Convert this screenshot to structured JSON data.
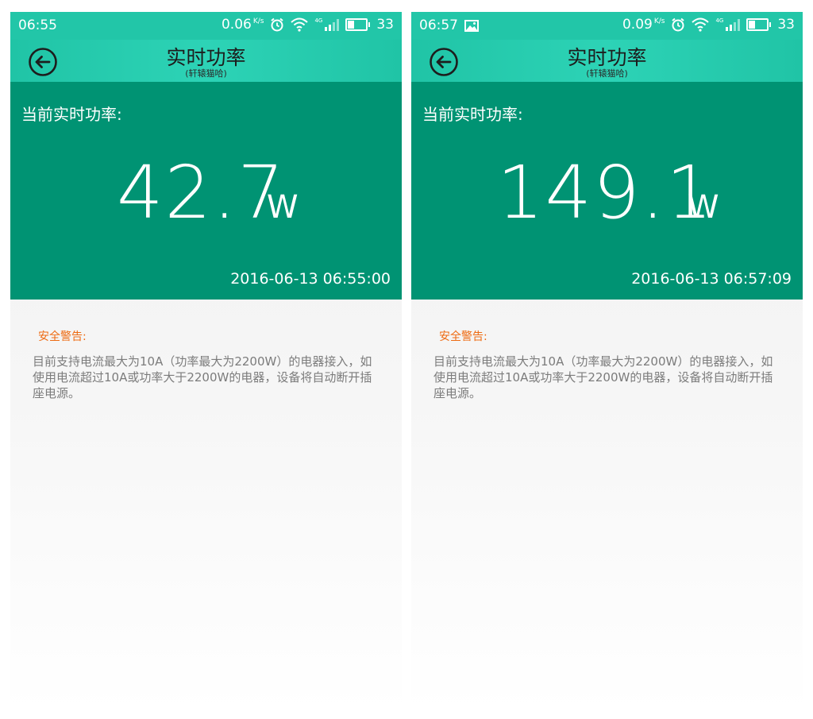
{
  "colors": {
    "status_bar": "#22c6a8",
    "title_bar": "#2dd3b6",
    "power_panel": "#009373",
    "warning_title": "#ee6b13",
    "warning_text": "#7c7c7c"
  },
  "screens": [
    {
      "status_bar": {
        "time": "06:55",
        "net_speed": "0.06",
        "net_speed_unit": "K/s",
        "battery": "33",
        "icons": [
          "alarm-icon",
          "wifi-icon",
          "cellular-4g-icon",
          "battery-icon"
        ]
      },
      "header": {
        "title": "实时功率",
        "subtitle": "(轩辕猫哈)",
        "back_icon": "back-arrow-icon"
      },
      "power": {
        "label": "当前实时功率:",
        "value": "42.7",
        "unit": "W",
        "timestamp": "2016-06-13 06:55:00"
      },
      "warning": {
        "title": "安全警告:",
        "text": "目前支持电流最大为10A（功率最大为2200W）的电器接入，如使用电流超过10A或功率大于2200W的电器，设备将自动断开插座电源。"
      }
    },
    {
      "status_bar": {
        "time": "06:57",
        "net_speed": "0.09",
        "net_speed_unit": "K/s",
        "battery": "33",
        "icons": [
          "image-notification-icon",
          "alarm-icon",
          "wifi-icon",
          "cellular-4g-icon",
          "battery-icon"
        ]
      },
      "header": {
        "title": "实时功率",
        "subtitle": "(轩辕猫哈)",
        "back_icon": "back-arrow-icon"
      },
      "power": {
        "label": "当前实时功率:",
        "value": "149.1",
        "unit": "W",
        "timestamp": "2016-06-13 06:57:09"
      },
      "warning": {
        "title": "安全警告:",
        "text": "目前支持电流最大为10A（功率最大为2200W）的电器接入，如使用电流超过10A或功率大于2200W的电器，设备将自动断开插座电源。"
      }
    }
  ]
}
